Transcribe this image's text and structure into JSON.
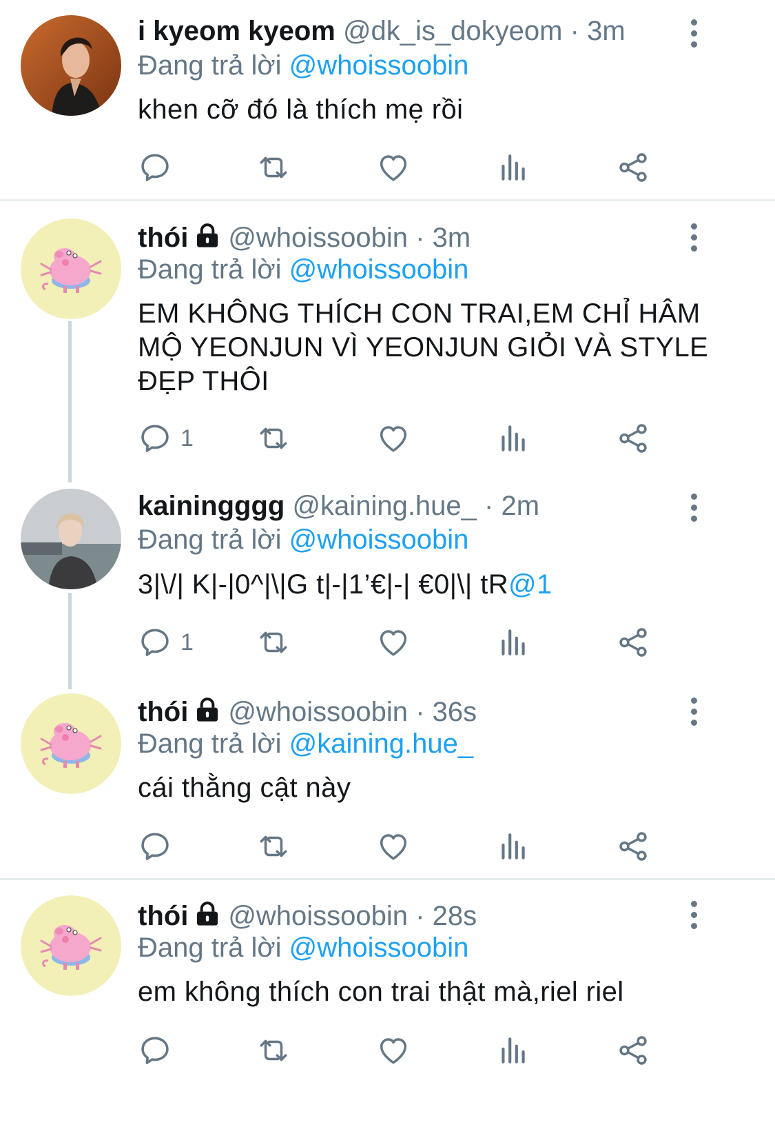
{
  "colors": {
    "accent": "#1da1f2",
    "muted": "#657786",
    "text": "#14171a",
    "divider": "#e6ecf0"
  },
  "tweets": [
    {
      "name": "i kyeom kyeom",
      "handle": "@dk_is_dokyeom",
      "time": "3m",
      "locked": false,
      "reply_prefix": "Đang trả lời",
      "reply_to": "@whoissoobin",
      "text": "khen cỡ đó là thích mẹ rồi",
      "reply_count": ""
    },
    {
      "name": "thói",
      "handle": "@whoissoobin",
      "time": "3m",
      "locked": true,
      "reply_prefix": "Đang trả lời",
      "reply_to": "@whoissoobin",
      "text": "EM KHÔNG THÍCH CON TRAI,EM CHỈ HÂM MỘ YEONJUN VÌ YEONJUN GIỎI VÀ STYLE ĐẸP THÔI",
      "reply_count": "1"
    },
    {
      "name": "kainingggg",
      "handle": "@kaining.hue_",
      "time": "2m",
      "locked": false,
      "reply_prefix": "Đang trả lời",
      "reply_to": "@whoissoobin",
      "text": "3|\\/| K|-|0^|\\|G t|-|1’€|-| €0|\\| tR",
      "text_mention": "@1",
      "reply_count": "1"
    },
    {
      "name": "thói",
      "handle": "@whoissoobin",
      "time": "36s",
      "locked": true,
      "reply_prefix": "Đang trả lời",
      "reply_to": "@kaining.hue_",
      "text": "cái thằng cật này",
      "reply_count": ""
    },
    {
      "name": "thói",
      "handle": "@whoissoobin",
      "time": "28s",
      "locked": true,
      "reply_prefix": "Đang trả lời",
      "reply_to": "@whoissoobin",
      "text": "em không thích con trai thật mà,riel riel",
      "reply_count": ""
    }
  ],
  "separator": "·",
  "icons": {
    "reply": "reply-icon",
    "retweet": "retweet-icon",
    "like": "like-icon",
    "analytics": "analytics-icon",
    "share": "share-icon",
    "more": "more-icon",
    "lock": "lock-icon"
  }
}
